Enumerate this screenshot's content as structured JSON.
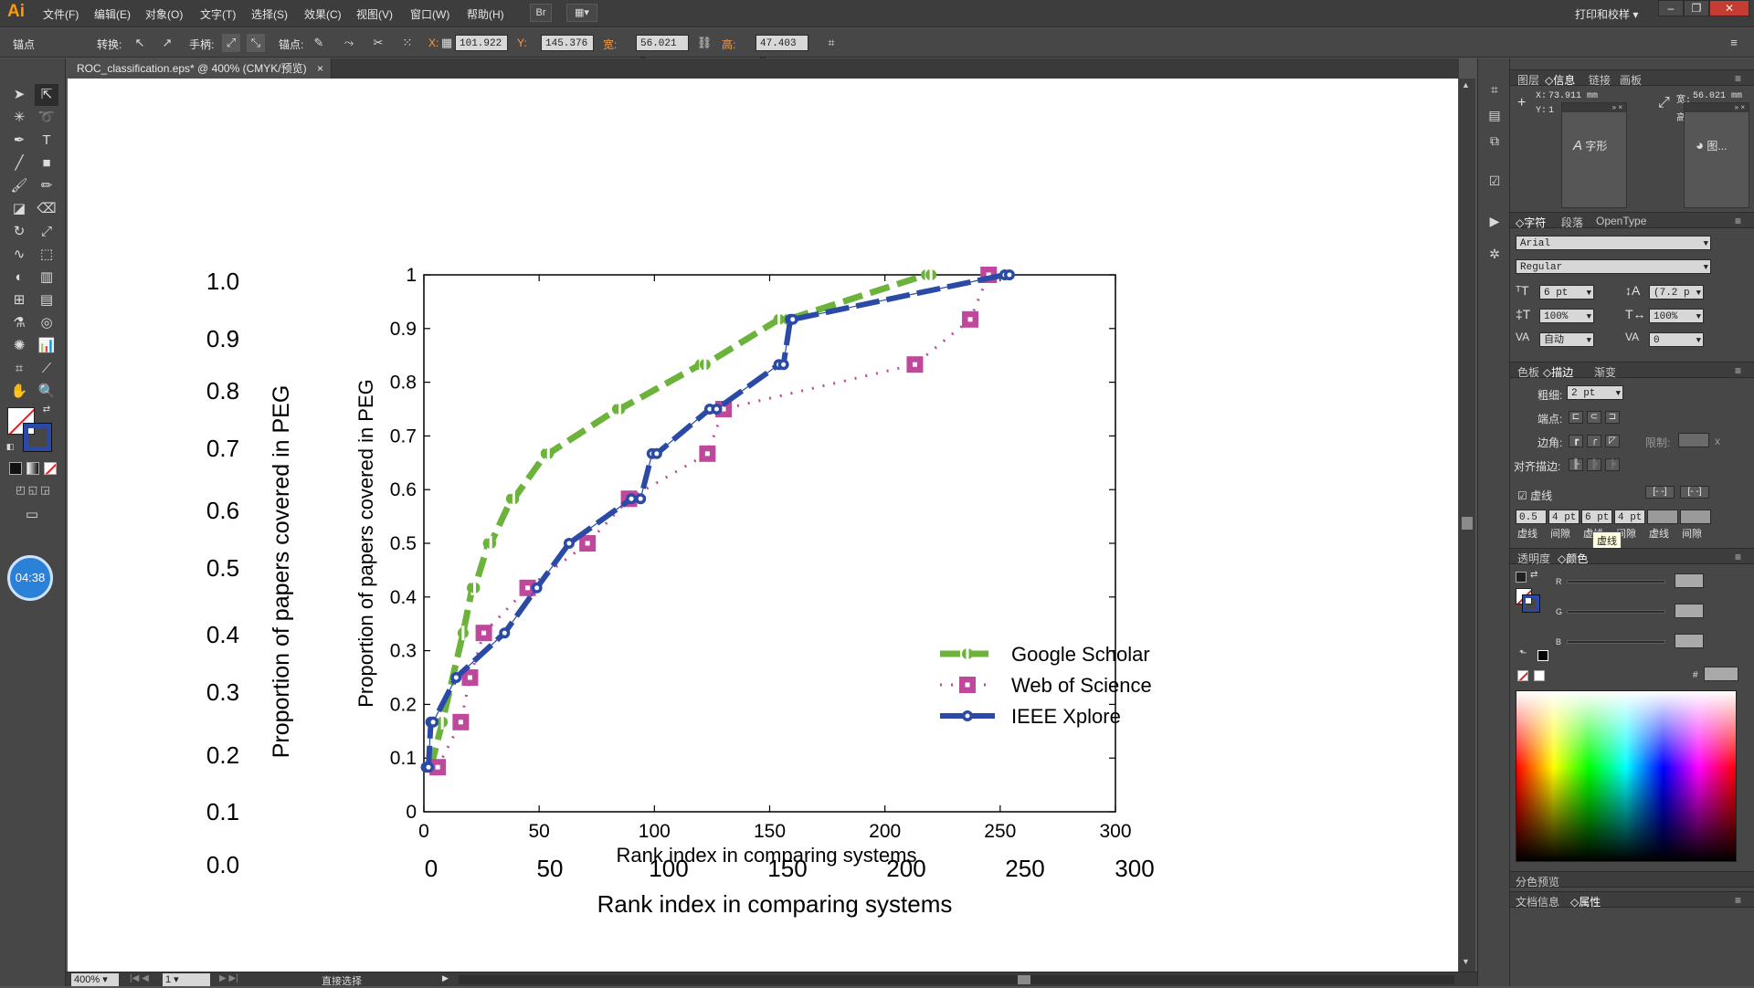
{
  "app": {
    "logo": "Ai",
    "menus": [
      "文件(F)",
      "编辑(E)",
      "对象(O)",
      "文字(T)",
      "选择(S)",
      "效果(C)",
      "视图(V)",
      "窗口(W)",
      "帮助(H)"
    ],
    "bridge_label": "Br",
    "workspace": "打印和校样",
    "window_buttons": [
      "–",
      "❐",
      "✕"
    ]
  },
  "control_bar": {
    "anchor_label": "锚点",
    "convert_label": "转换:",
    "handles_label": "手柄:",
    "anchors_label": "锚点:",
    "x_label": "X:",
    "x_value": "101.922",
    "y_label": "Y:",
    "y_value": "145.376",
    "w_label": "宽:",
    "w_value": "56.021 m",
    "h_label": "高:",
    "h_value": "47.403 m"
  },
  "document": {
    "tab_title": "ROC_classification.eps* @ 400% (CMYK/预览)",
    "zoom": "400%",
    "artboard": "1",
    "status_tool": "直接选择"
  },
  "timer": "04:38",
  "chart_data": {
    "type": "line",
    "xlabel": "Rank index in comparing systems",
    "ylabel": "Proportion of papers covered in PEG",
    "xlim": [
      0,
      300
    ],
    "ylim": [
      0,
      1
    ],
    "x_ticks": [
      "0",
      "50",
      "100",
      "150",
      "200",
      "250",
      "300"
    ],
    "y_ticks": [
      "0",
      "0.1",
      "0.2",
      "0.3",
      "0.4",
      "0.5",
      "0.6",
      "0.7",
      "0.8",
      "0.9",
      "1"
    ],
    "legend": "bottom-right",
    "series": [
      {
        "name": "Google Scholar",
        "color": "#6bb33a",
        "x": [
          3,
          8,
          17,
          21,
          22,
          28,
          29,
          38,
          39,
          53,
          54,
          84,
          85,
          120,
          122,
          154,
          158,
          218,
          220
        ],
        "y": [
          0.083,
          0.167,
          0.333,
          0.417,
          0.417,
          0.5,
          0.5,
          0.583,
          0.583,
          0.667,
          0.667,
          0.75,
          0.75,
          0.833,
          0.833,
          0.917,
          0.917,
          1.0,
          1.0
        ]
      },
      {
        "name": "Web of Science",
        "color": "#c0489c",
        "x": [
          6,
          16,
          20,
          26,
          45,
          71,
          89,
          123,
          130,
          213,
          237,
          245
        ],
        "y": [
          0.083,
          0.167,
          0.25,
          0.333,
          0.417,
          0.5,
          0.583,
          0.667,
          0.75,
          0.833,
          0.917,
          1.0
        ]
      },
      {
        "name": "IEEE Xplore",
        "color": "#2b4aa6",
        "x": [
          1,
          2,
          3,
          4,
          14,
          35,
          49,
          63,
          90,
          94,
          99,
          101,
          124,
          127,
          154,
          156,
          159,
          160,
          252,
          254
        ],
        "y": [
          0.083,
          0.083,
          0.167,
          0.167,
          0.25,
          0.333,
          0.417,
          0.5,
          0.583,
          0.583,
          0.667,
          0.667,
          0.75,
          0.75,
          0.833,
          0.833,
          0.917,
          0.917,
          1.0,
          1.0
        ]
      }
    ]
  },
  "overlay_labels": {
    "y_ticks": [
      "1.0",
      "0.9",
      "0.8",
      "0.7",
      "0.6",
      "0.5",
      "0.4",
      "0.3",
      "0.2",
      "0.1",
      "0.0"
    ],
    "x_ticks": [
      "0",
      "50",
      "100",
      "150",
      "200",
      "250",
      "300"
    ],
    "ylabel": "Proportion of papers covered in PEG",
    "xlabel": "Rank index in comparing systems"
  },
  "panels": {
    "info_tabs": [
      "图层",
      "◇信息",
      "链接",
      "画板"
    ],
    "info": {
      "x_label": "X:",
      "x_value": "73.911 mm",
      "y_label": "Y:",
      "y_value": "1",
      "w_label": "宽:",
      "w_value": "56.021 mm",
      "h_label": "高:"
    },
    "glyph_popup": "字形",
    "graphic_popup": "图...",
    "char_tabs": [
      "◇字符",
      "段落",
      "OpenType"
    ],
    "font_family": "Arial",
    "font_style": "Regular",
    "font_size": "6 pt",
    "leading": "(7.2 p",
    "vscale": "100%",
    "hscale": "100%",
    "kerning": "自动",
    "tracking": "0",
    "stroke_tabs": [
      "色板",
      "◇描边",
      "渐变"
    ],
    "weight_label": "粗细:",
    "weight_value": "2 pt",
    "cap_label": "端点:",
    "corner_label": "边角:",
    "limit_label": "限制:",
    "limit_suffix": "x",
    "align_label": "对齐描边:",
    "dashed_label": "虚线",
    "dash_values": [
      "0.5 p",
      "4 pt",
      "6 pt",
      "4 pt",
      "",
      ""
    ],
    "dash_labels": [
      "虚线",
      "间隙",
      "虚线",
      "间隙",
      "虚线",
      "间隙"
    ],
    "tooltip": "虚线",
    "color_tabs": [
      "透明度",
      "◇颜色"
    ],
    "rgb_labels": [
      "R",
      "G",
      "B"
    ],
    "hex_label": "#",
    "sep_preview": "分色预览",
    "doc_info_tabs": [
      "文档信息",
      "◇属性"
    ]
  }
}
